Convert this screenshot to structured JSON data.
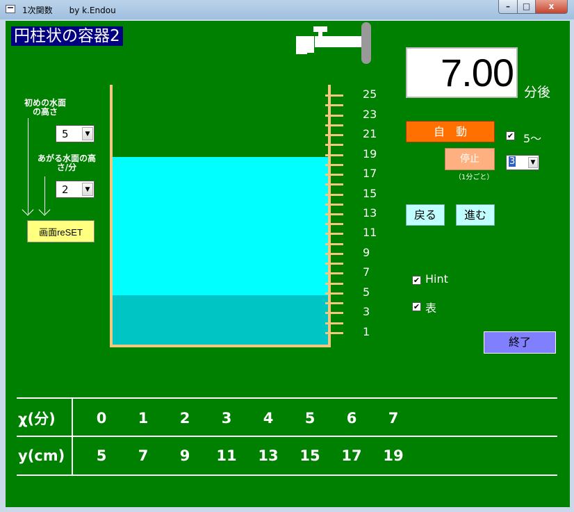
{
  "window": {
    "title": "1次関数　　by k.Endou",
    "min_label": "–",
    "max_label": "□",
    "close_label": "x"
  },
  "app": {
    "title": "円柱状の容器2"
  },
  "controls": {
    "initial_label": "初めの水面の高さ",
    "initial_value": "5",
    "rise_label": "あがる水面の高さ/分",
    "rise_value": "2",
    "reset_label": "画面reSET",
    "dropdown_arrow": "▼"
  },
  "timer": {
    "value": "7.00",
    "unit": "分後"
  },
  "auto": {
    "label": "自　動",
    "check_label": "5〜",
    "checked": true
  },
  "stop": {
    "label": "停止",
    "note": "（1分ごと）",
    "interval_value": "3"
  },
  "nav": {
    "back_label": "戻る",
    "next_label": "進む"
  },
  "options": {
    "hint_label": "Hint",
    "hint_checked": true,
    "table_label": "表",
    "table_checked": true,
    "check_mark": "✔"
  },
  "end_label": "終了",
  "container": {
    "scale_max": 26,
    "scale_labels": [
      "25",
      "23",
      "21",
      "19",
      "17",
      "15",
      "13",
      "11",
      "9",
      "7",
      "5",
      "3",
      "1"
    ],
    "water_level": 19,
    "initial_level": 5,
    "colors": {
      "water": "#00ffff",
      "initial_water": "#00c5c5",
      "wall": "#f3c77e",
      "background": "#008000"
    }
  },
  "table": {
    "x_header": "χ(分)",
    "y_header": "y(cm)",
    "x_values": [
      "0",
      "1",
      "2",
      "3",
      "4",
      "5",
      "6",
      "7"
    ],
    "y_values": [
      "5",
      "7",
      "9",
      "11",
      "13",
      "15",
      "17",
      "19"
    ]
  }
}
